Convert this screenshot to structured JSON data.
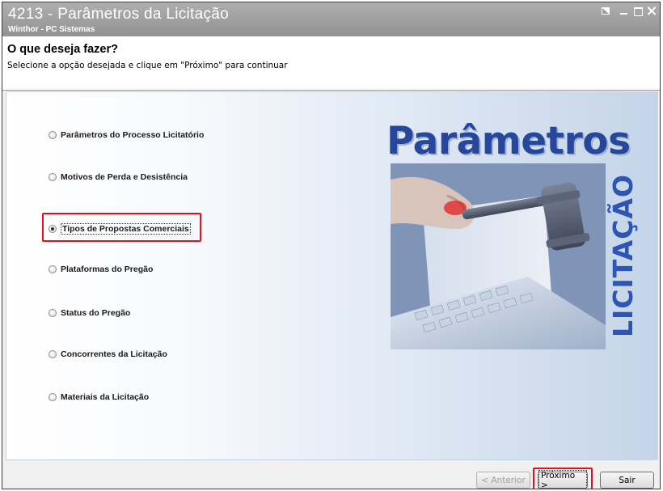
{
  "window": {
    "title": "4213 - Parâmetros da Licitação",
    "subtitle": "Winthor - PC Sistemas"
  },
  "header": {
    "heading": "O que deseja fazer?",
    "instruction": "Selecione a opção desejada e clique em \"Próximo\" para continuar"
  },
  "options": [
    {
      "label": "Parâmetros do Processo Licitatório",
      "checked": false
    },
    {
      "label": "Motivos de Perda e Desistência",
      "checked": false
    },
    {
      "label": "Tipos de Propostas Comerciais",
      "checked": true
    },
    {
      "label": "Plataformas do Pregão",
      "checked": false
    },
    {
      "label": "Status do Pregão",
      "checked": false
    },
    {
      "label": "Concorrentes da Licitação",
      "checked": false
    },
    {
      "label": "Materiais da Licitação",
      "checked": false
    }
  ],
  "banner": {
    "title": "Parâmetros",
    "vertical_text": "LICITAÇÃO"
  },
  "footer": {
    "prev_label": "< Anterior",
    "next_label": "Próximo >",
    "exit_label": "Sair"
  },
  "colors": {
    "highlight": "#e0101c",
    "banner_title": "#27489a",
    "vertical_text": "#2e55b3"
  }
}
